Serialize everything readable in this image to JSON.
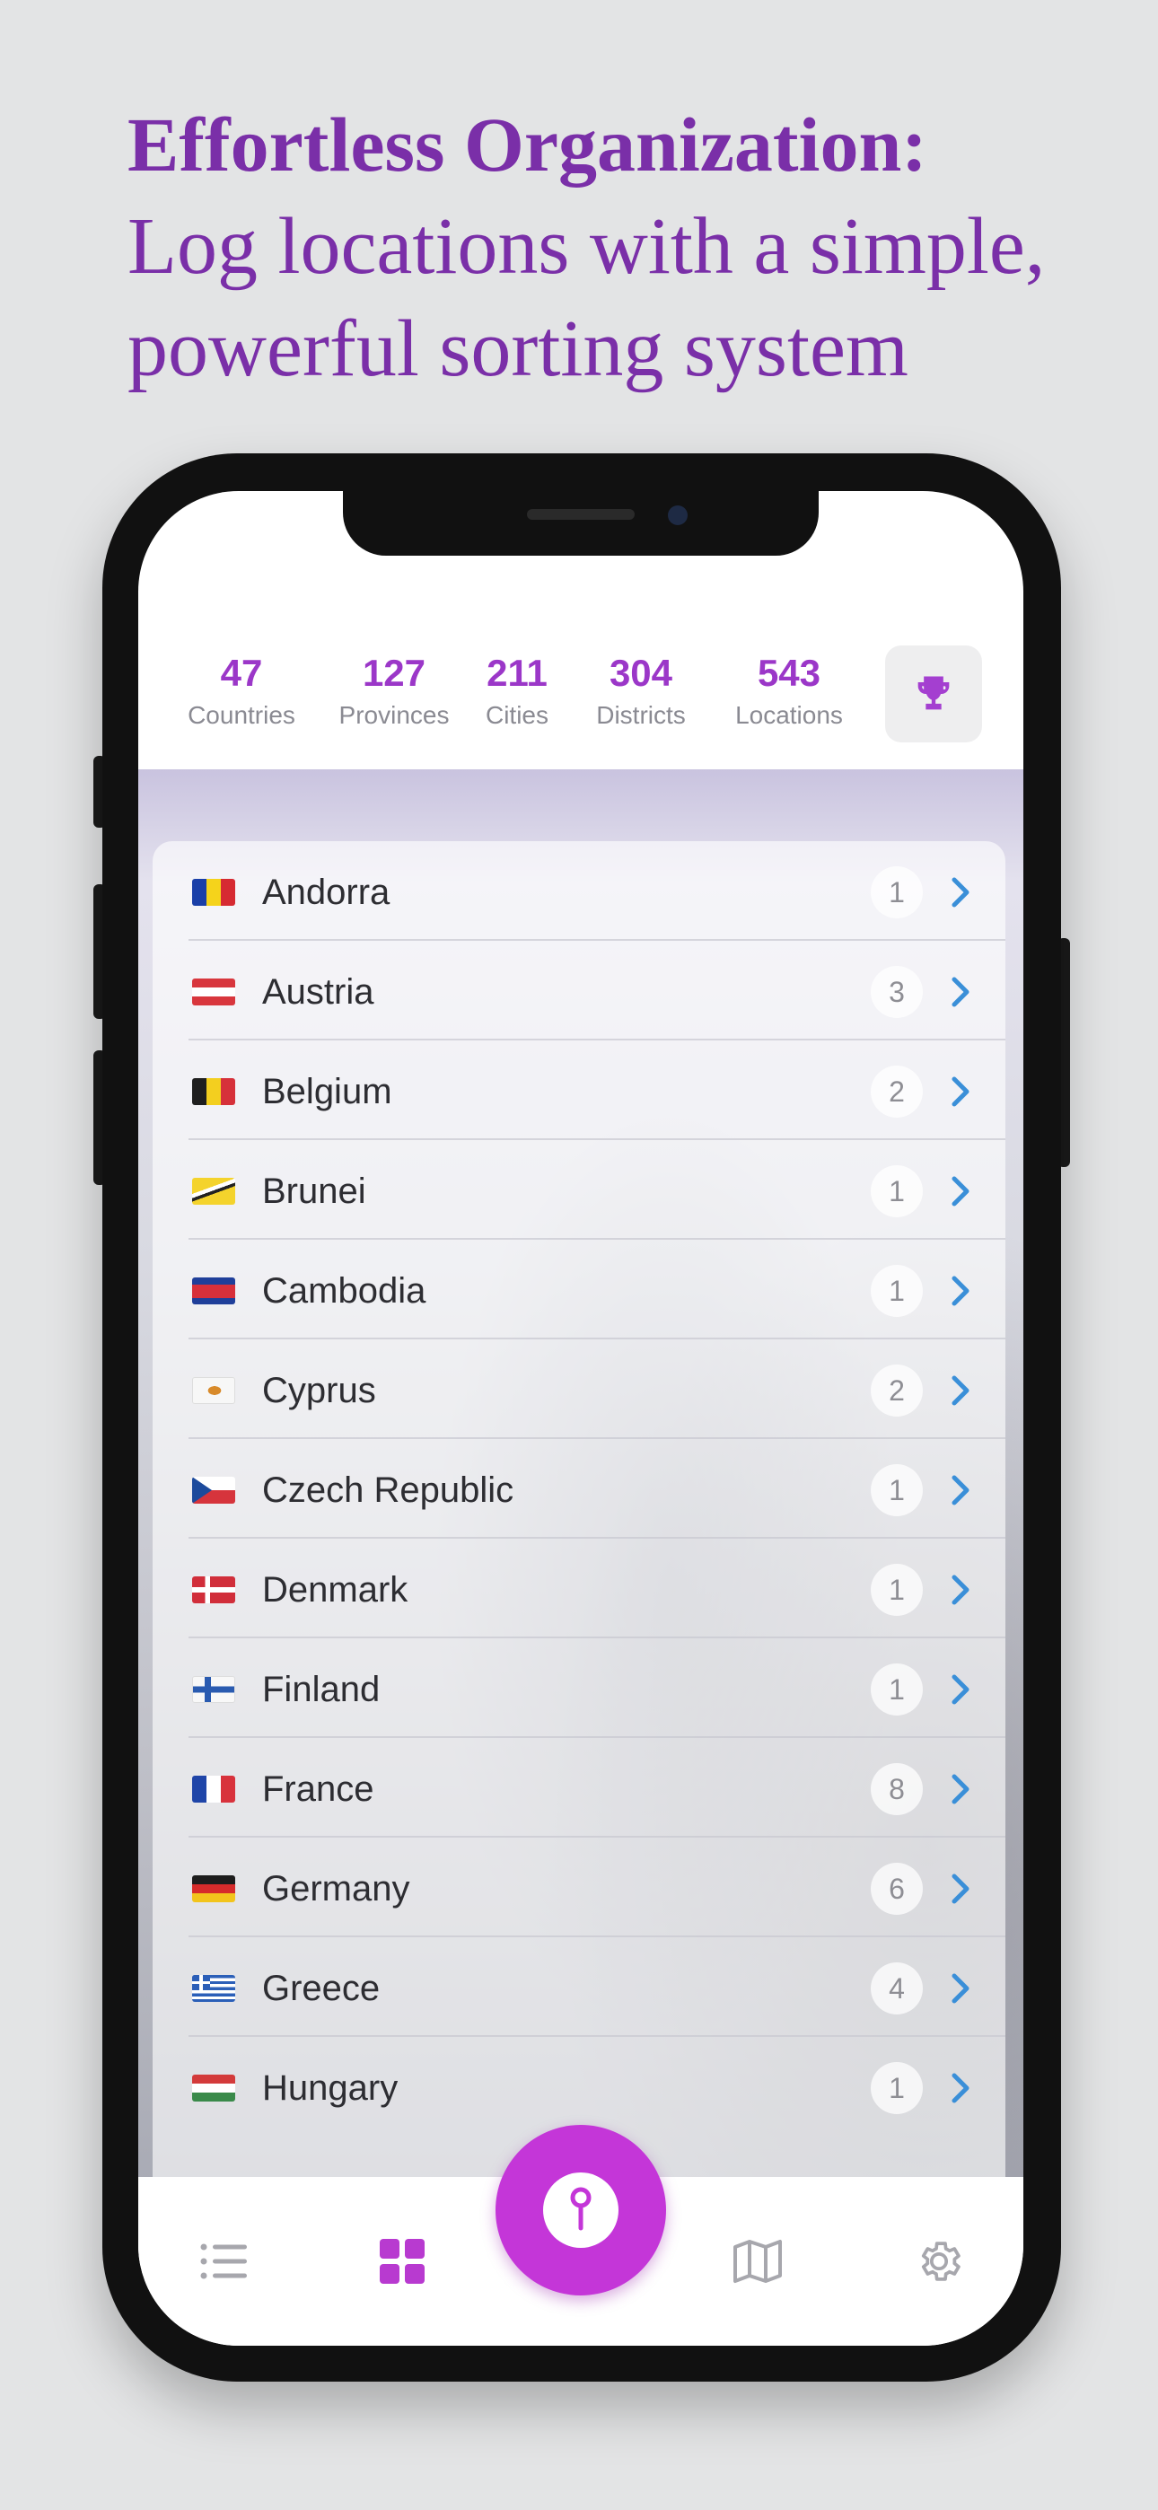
{
  "headline": {
    "bold": "Effortless Organization:",
    "line2": "Log locations with a simple,",
    "line3": "powerful sorting system"
  },
  "stats": [
    {
      "value": "47",
      "label": "Countries"
    },
    {
      "value": "127",
      "label": "Provinces"
    },
    {
      "value": "211",
      "label": "Cities"
    },
    {
      "value": "304",
      "label": "Districts"
    },
    {
      "value": "543",
      "label": "Locations"
    }
  ],
  "countries": [
    {
      "name": "Andorra",
      "count": "1",
      "flag": "andorra-flag"
    },
    {
      "name": "Austria",
      "count": "3",
      "flag": "austria-flag"
    },
    {
      "name": "Belgium",
      "count": "2",
      "flag": "belgium-flag"
    },
    {
      "name": "Brunei",
      "count": "1",
      "flag": "brunei-flag"
    },
    {
      "name": "Cambodia",
      "count": "1",
      "flag": "cambodia-flag"
    },
    {
      "name": "Cyprus",
      "count": "2",
      "flag": "cyprus-flag"
    },
    {
      "name": "Czech Republic",
      "count": "1",
      "flag": "czech-flag"
    },
    {
      "name": "Denmark",
      "count": "1",
      "flag": "denmark-flag"
    },
    {
      "name": "Finland",
      "count": "1",
      "flag": "finland-flag"
    },
    {
      "name": "France",
      "count": "8",
      "flag": "france-flag"
    },
    {
      "name": "Germany",
      "count": "6",
      "flag": "germany-flag"
    },
    {
      "name": "Greece",
      "count": "4",
      "flag": "greece-flag"
    },
    {
      "name": "Hungary",
      "count": "1",
      "flag": "hungary-flag"
    }
  ],
  "tabs": {
    "list": "list-icon",
    "grid": "grid-icon",
    "add": "map-pin-icon",
    "map": "map-icon",
    "settings": "gear-icon"
  },
  "colors": {
    "accent": "#9b37c8",
    "fab": "#c436d8",
    "headline": "#7a2fa8",
    "chevron": "#3a8fd8"
  }
}
